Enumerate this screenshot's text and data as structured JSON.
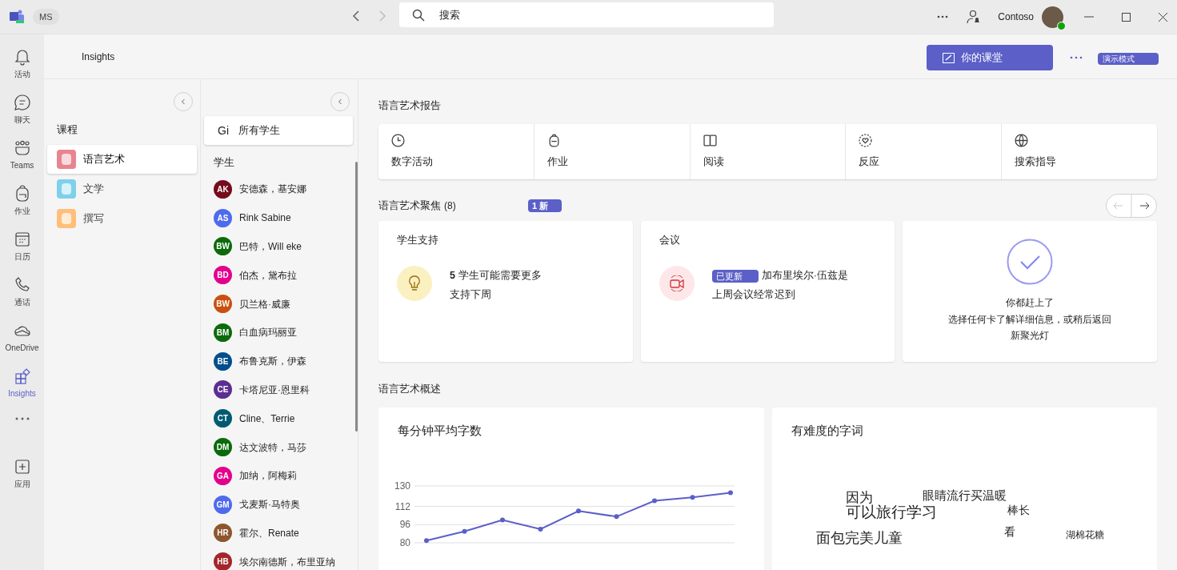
{
  "title_bar": {
    "org": "MS",
    "search": {
      "placeholder": "搜索"
    },
    "account": "Contoso"
  },
  "rail": [
    {
      "label": "活动",
      "selected": false
    },
    {
      "label": "聊天",
      "selected": false
    },
    {
      "label": "Teams",
      "selected": false
    },
    {
      "label": "作业",
      "selected": false
    },
    {
      "label": "日历",
      "selected": false
    },
    {
      "label": "通话",
      "selected": false
    },
    {
      "label": "OneDrive",
      "selected": false
    },
    {
      "label": "Insights",
      "selected": true
    },
    {
      "label": "应用",
      "selected": false
    }
  ],
  "header": {
    "title": "Insights",
    "classroom_button": "你的课堂",
    "demo_badge": "演示模式"
  },
  "courses": {
    "heading": "课程",
    "items": [
      {
        "label": "语言艺术",
        "selected": true,
        "color": "#e8848f"
      },
      {
        "label": "文学",
        "selected": false,
        "color": "#7fd0ea"
      },
      {
        "label": "撰写",
        "selected": false,
        "color": "#ffbf7a"
      }
    ]
  },
  "students": {
    "all": {
      "initials": "Gi",
      "label": "所有学生",
      "selected": true
    },
    "heading": "学生",
    "items": [
      {
        "initials": "AK",
        "name": "安德森，基安娜",
        "color": "#750b1c",
        "selected": false
      },
      {
        "initials": "AS",
        "name": "Rink Sabine",
        "color": "#4f6bed",
        "selected": false
      },
      {
        "initials": "BW",
        "name": "巴特，Will eke",
        "color": "#0b6a0b",
        "selected": false
      },
      {
        "initials": "BD",
        "name": "伯杰，黛布拉",
        "color": "#e3008c",
        "selected": false
      },
      {
        "initials": "BW",
        "name": "贝兰格·威廉",
        "color": "#ca5010",
        "selected": false
      },
      {
        "initials": "BM",
        "name": "白血病玛丽亚",
        "color": "#0b6a0b",
        "selected": false
      },
      {
        "initials": "BE",
        "name": "布鲁克斯，伊森",
        "color": "#004e8c",
        "selected": false
      },
      {
        "initials": "CE",
        "name": "卡塔尼亚·恩里科",
        "color": "#5c2e91",
        "selected": false
      },
      {
        "initials": "CT",
        "name": "Cline、Terrie",
        "color": "#005b70",
        "selected": false
      },
      {
        "initials": "DM",
        "name": "达文波特，马莎",
        "color": "#0b6a0b",
        "selected": false
      },
      {
        "initials": "GA",
        "name": "加纳，阿梅莉",
        "color": "#e3008c",
        "selected": false
      },
      {
        "initials": "GM",
        "name": "戈麦斯·马特奥",
        "color": "#4f6bed",
        "selected": false
      },
      {
        "initials": "HR",
        "name": "霍尔、Renate",
        "color": "#8e562e",
        "selected": false
      },
      {
        "initials": "HB",
        "name": "埃尔南德斯，布里亚纳",
        "color": "#a4262c",
        "selected": false
      }
    ]
  },
  "report": {
    "heading": "语言艺术报告",
    "tiles": [
      "数字活动",
      "作业",
      "阅读",
      "反应",
      "搜索指导"
    ]
  },
  "spotlight": {
    "heading": "语言艺术聚焦",
    "count": "(8)",
    "badge": "1 新",
    "cards": [
      {
        "kind": "support",
        "title": "学生支持",
        "count": "5",
        "line1": "学生可能需要更多",
        "line2": "支持下周"
      },
      {
        "kind": "meeting",
        "title": "会议",
        "badge": "已更新",
        "line1": "加布里埃尔·伍兹是",
        "line2": "上周会议经常迟到"
      },
      {
        "kind": "done",
        "line1": "你都赶上了",
        "line2": "选择任何卡了解详细信息，或稍后返回",
        "line3": "新聚光灯"
      }
    ]
  },
  "overview": {
    "heading": "语言艺术概述",
    "wpm": {
      "chart_data": {
        "type": "line",
        "ylim": [
          80,
          130
        ],
        "yticks": [
          80,
          96,
          112,
          130
        ],
        "series": [
          {
            "name": "每分钟平均字数",
            "color": "#5b5fc7",
            "marker": "circle",
            "values": [
              82,
              90,
              100,
              92,
              108,
              103,
              117,
              120,
              124
            ]
          }
        ]
      }
    },
    "words": {
      "title": "有难度的字词",
      "items": [
        "因为",
        "眼睛流行买温暖",
        "可以旅行学习",
        "棒长",
        "看",
        "面包完美儿童",
        "湖棉花糖"
      ]
    }
  }
}
